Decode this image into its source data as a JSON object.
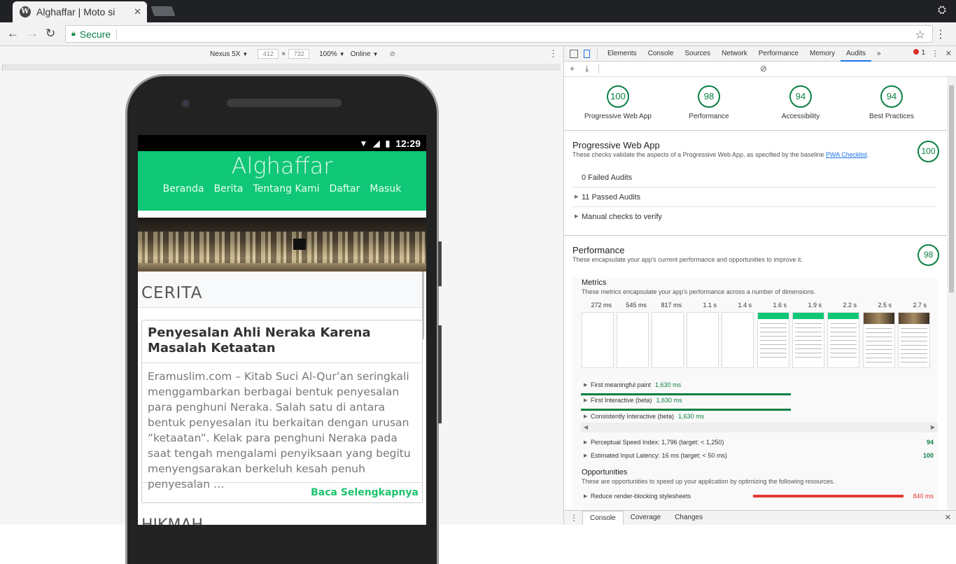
{
  "browser": {
    "tab_title": "Alghaffar | Moto si",
    "tab_close": "✕",
    "secure_label": "Secure"
  },
  "device_toolbar": {
    "device": "Nexus 5X",
    "width": "412",
    "x": "×",
    "height": "732",
    "zoom": "100%",
    "network": "Online"
  },
  "phone_status": {
    "time": "12:29"
  },
  "site": {
    "title": "Alghaffar",
    "nav": [
      "Beranda",
      "Berita",
      "Tentang Kami",
      "Daftar",
      "Masuk"
    ],
    "section_title": "CERITA",
    "card_title": "Penyesalan Ahli Neraka Karena Masalah Ketaatan",
    "card_body": "Eramuslim.com – Kitab Suci Al-Qur’an seringkali menggambarkan berbagai bentuk penyesalan para penghuni Neraka. Salah satu di antara bentuk penyesalan itu berkaitan dengan urusan ”ketaatan”. Kelak para penghuni Neraka pada saat tengah mengalami penyiksaan yang begitu menyengsarakan berkeluh kesah penuh penyesalan …",
    "read_more": "Baca Selengkapnya",
    "next_section": "HIKMAH"
  },
  "devtools": {
    "tabs": [
      "Elements",
      "Console",
      "Sources",
      "Network",
      "Performance",
      "Memory",
      "Audits"
    ],
    "active_tab": "Audits",
    "more": "»",
    "error_count": "1",
    "gauges": [
      {
        "score": "100",
        "label": "Progressive Web App"
      },
      {
        "score": "98",
        "label": "Performance"
      },
      {
        "score": "94",
        "label": "Accessibility"
      },
      {
        "score": "94",
        "label": "Best Practices"
      }
    ],
    "pwa": {
      "title": "Progressive Web App",
      "desc": "These checks validate the aspects of a Progressive Web App, as specified by the baseline ",
      "link": "PWA Checklist",
      "score": "100",
      "rows": [
        "0 Failed Audits",
        "11 Passed Audits",
        "Manual checks to verify"
      ]
    },
    "performance": {
      "title": "Performance",
      "desc": "These encapsulate your app's current performance and opportunities to improve it.",
      "score": "98",
      "metrics_title": "Metrics",
      "metrics_desc": "These metrics encapsulate your app's performance across a number of dimensions.",
      "timings": [
        "272 ms",
        "545 ms",
        "817 ms",
        "1.1 s",
        "1.4 s",
        "1.6 s",
        "1.9 s",
        "2.2 s",
        "2.5 s",
        "2.7 s"
      ],
      "metrics": [
        {
          "name": "First meaningful paint",
          "value": "1,630 ms"
        },
        {
          "name": "First Interactive (beta)",
          "value": "1,630 ms"
        },
        {
          "name": "Consistently Interactive (beta)",
          "value": "1,630 ms"
        }
      ],
      "psi": {
        "name": "Perceptual Speed Index: 1,796 (target: < 1,250)",
        "score": "94"
      },
      "eil": {
        "name": "Estimated Input Latency: 16 ms (target: < 50 ms)",
        "score": "100"
      },
      "opp_title": "Opportunities",
      "opp_desc": "These are opportunities to speed up your application by optimizing the following resources.",
      "opp_row": {
        "name": "Reduce render-blocking stylesheets",
        "value": "840 ms"
      }
    },
    "drawer_tabs": [
      "Console",
      "Coverage",
      "Changes"
    ]
  }
}
